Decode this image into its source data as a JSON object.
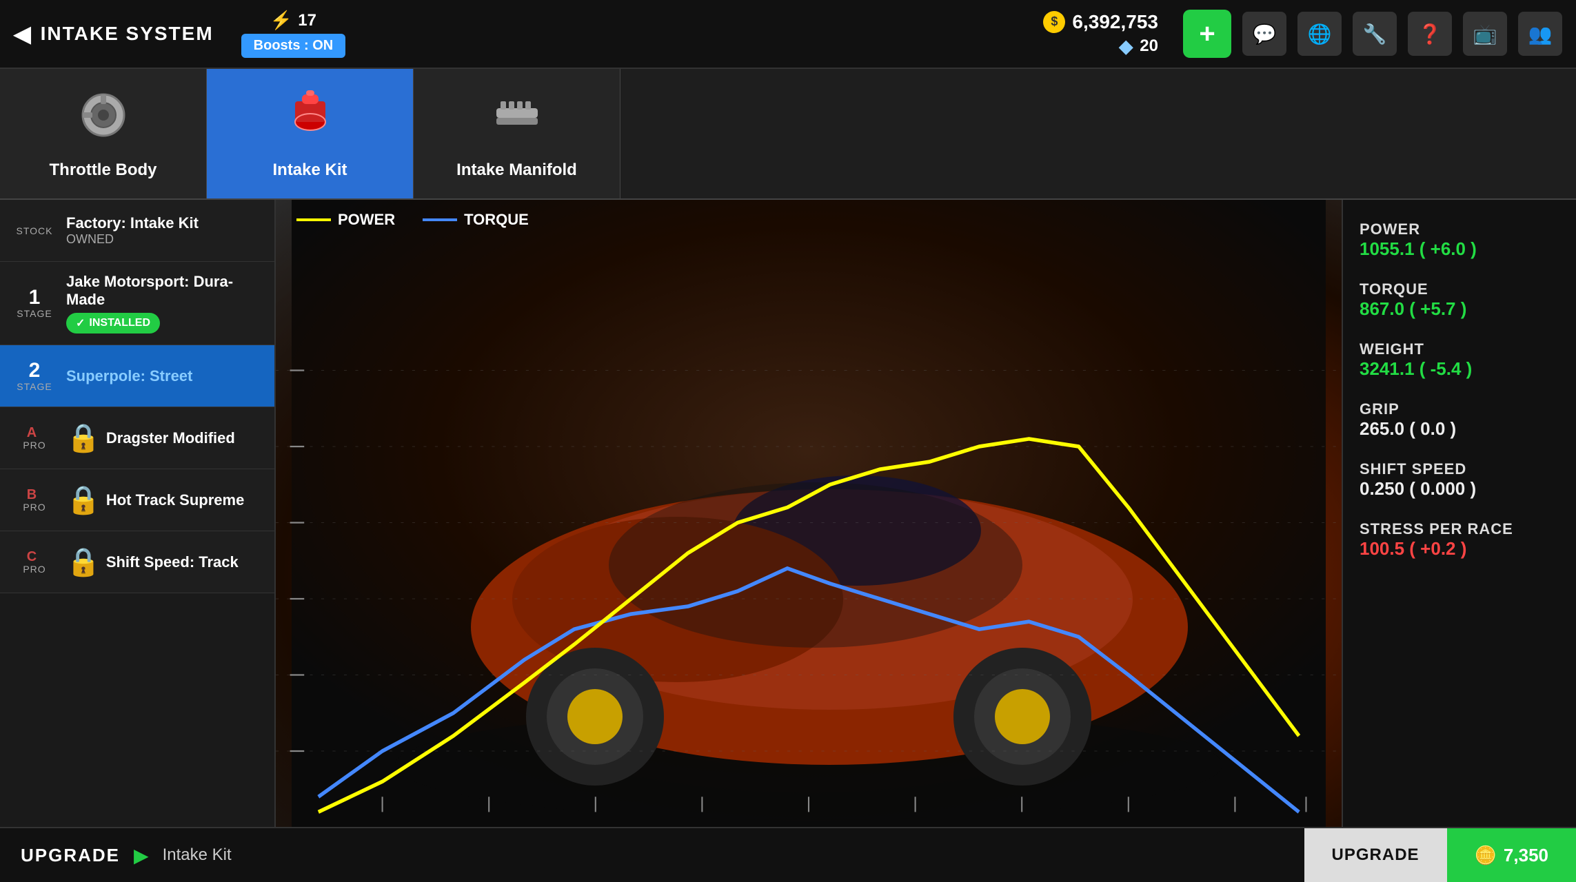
{
  "header": {
    "back_label": "INTAKE SYSTEM",
    "energy": "17",
    "energy_icon": "⚡",
    "boost_label": "Boosts : ON",
    "currency_gold": "6,392,753",
    "currency_diamond": "20",
    "add_btn_label": "+",
    "nav_icons": [
      "💬",
      "🌐",
      "🔧",
      "❓",
      "📺",
      "👥"
    ]
  },
  "tabs": [
    {
      "id": "throttle-body",
      "label": "Throttle Body",
      "active": false,
      "icon": "⚙"
    },
    {
      "id": "intake-kit",
      "label": "Intake Kit",
      "active": true,
      "icon": "🔴"
    },
    {
      "id": "intake-manifold",
      "label": "Intake Manifold",
      "active": false,
      "icon": "🔩"
    }
  ],
  "upgrades": [
    {
      "id": "stock",
      "stage_number": "",
      "stage_label": "STOCK",
      "name": "Factory: Intake Kit",
      "sub": "OWNED",
      "status": "owned",
      "locked": false,
      "selected": false
    },
    {
      "id": "stage1",
      "stage_number": "1",
      "stage_label": "STAGE",
      "name": "Jake Motorsport: Dura-Made",
      "sub": "",
      "status": "installed",
      "locked": false,
      "selected": false
    },
    {
      "id": "stage2",
      "stage_number": "2",
      "stage_label": "STAGE",
      "name": "Superpole: Street",
      "sub": "",
      "status": "selected",
      "locked": false,
      "selected": true
    },
    {
      "id": "pro-a",
      "stage_number": "A",
      "stage_label": "PRO",
      "name": "Dragster Modified",
      "sub": "",
      "status": "locked",
      "locked": true,
      "selected": false
    },
    {
      "id": "pro-b",
      "stage_number": "B",
      "stage_label": "PRO",
      "name": "Hot Track Supreme",
      "sub": "",
      "status": "locked",
      "locked": true,
      "selected": false
    },
    {
      "id": "pro-c",
      "stage_number": "C",
      "stage_label": "PRO",
      "name": "Shift Speed: Track",
      "sub": "",
      "status": "locked",
      "locked": true,
      "selected": false
    }
  ],
  "chart": {
    "legend_power": "POWER",
    "legend_torque": "TORQUE"
  },
  "stats": [
    {
      "name": "POWER",
      "value": "1055.1 ( +6.0 )",
      "type": "positive"
    },
    {
      "name": "TORQUE",
      "value": "867.0 ( +5.7 )",
      "type": "positive"
    },
    {
      "name": "WEIGHT",
      "value": "3241.1 ( -5.4 )",
      "type": "positive"
    },
    {
      "name": "GRIP",
      "value": "265.0 ( 0.0 )",
      "type": "neutral"
    },
    {
      "name": "SHIFT SPEED",
      "value": "0.250 ( 0.000 )",
      "type": "neutral"
    },
    {
      "name": "STRESS PER RACE",
      "value": "100.5 ( +0.2 )",
      "type": "negative"
    }
  ],
  "bottom_bar": {
    "upgrade_label": "UPGRADE",
    "upgrade_item": "Intake Kit",
    "upgrade_action": "UPGRADE",
    "upgrade_cost": "7,350",
    "cost_icon": "🪙"
  }
}
